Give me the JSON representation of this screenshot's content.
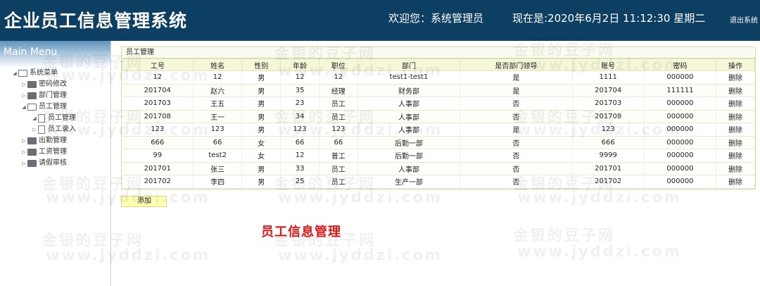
{
  "header": {
    "title": "企业员工信息管理系统",
    "welcome": "欢迎您：系统管理员",
    "datetime": "现在是:2020年6月2日 11:12:30 星期二",
    "logout": "退出系统"
  },
  "sidebar": {
    "heading": "Main Menu",
    "root": "系统菜单",
    "items": [
      {
        "label": "密码修改",
        "icon": "folder-icon"
      },
      {
        "label": "部门管理",
        "icon": "folder-icon"
      },
      {
        "label": "员工管理",
        "icon": "folder-open-icon"
      },
      {
        "label": "员工管理",
        "icon": "file-icon"
      },
      {
        "label": "员工录入",
        "icon": "file-icon"
      },
      {
        "label": "出勤管理",
        "icon": "folder-icon"
      },
      {
        "label": "工资管理",
        "icon": "folder-icon"
      },
      {
        "label": "请假审核",
        "icon": "folder-icon"
      }
    ]
  },
  "panel": {
    "title": "员工管理",
    "columns": [
      "工号",
      "姓名",
      "性别",
      "年龄",
      "职位",
      "部门",
      "是否部门领导",
      "账号",
      "密码",
      "操作"
    ],
    "rows": [
      [
        "12",
        "12",
        "男",
        "12",
        "12",
        "test1-test1",
        "是",
        "1111",
        "000000",
        "删除"
      ],
      [
        "201704",
        "赵六",
        "男",
        "35",
        "经理",
        "财务部",
        "是",
        "201704",
        "111111",
        "删除"
      ],
      [
        "201703",
        "王五",
        "男",
        "23",
        "员工",
        "人事部",
        "否",
        "201703",
        "000000",
        "删除"
      ],
      [
        "201708",
        "王一",
        "男",
        "34",
        "员工",
        "人事部",
        "否",
        "201708",
        "000000",
        "删除"
      ],
      [
        "123",
        "123",
        "男",
        "123",
        "123",
        "人事部",
        "是",
        "123",
        "000000",
        "删除"
      ],
      [
        "666",
        "66",
        "女",
        "66",
        "66",
        "后勤一部",
        "否",
        "666",
        "000000",
        "删除"
      ],
      [
        "99",
        "test2",
        "女",
        "12",
        "普工",
        "后勤一部",
        "否",
        "9999",
        "000000",
        "删除"
      ],
      [
        "201701",
        "张三",
        "男",
        "33",
        "员工",
        "人事部",
        "否",
        "201701",
        "000000",
        "删除"
      ],
      [
        "201702",
        "李四",
        "男",
        "25",
        "员工",
        "生产一部",
        "否",
        "201702",
        "000000",
        "删除"
      ]
    ],
    "add_label": "添加"
  },
  "caption": "员工信息管理",
  "watermark": {
    "line1": "金银的豆子网",
    "line2": "www.jyddzi.com"
  },
  "colors": {
    "header_bg": "#0d3f63",
    "caption": "#e0191a",
    "add_button": "#ffffb4"
  }
}
